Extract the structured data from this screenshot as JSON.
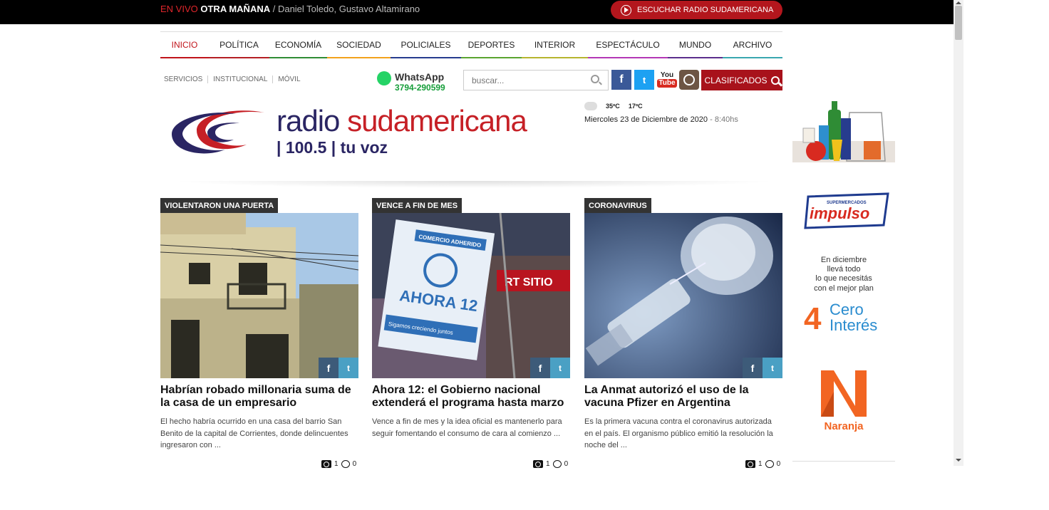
{
  "topbar": {
    "live_tag": "EN VIVO",
    "show_name": "OTRA MAÑANA",
    "hosts": " / Daniel Toledo, Gustavo Altamirano",
    "listen_button": "ESCUCHAR RADIO SUDAMERICANA",
    "listen_icon": "play-icon"
  },
  "nav": {
    "items": [
      {
        "label": "INICIO",
        "color": "#c0141a"
      },
      {
        "label": "POLÍTICA",
        "color": "#b51f24"
      },
      {
        "label": "ECONOMÍA",
        "color": "#2f8c35"
      },
      {
        "label": "SOCIEDAD",
        "color": "#f2a21c"
      },
      {
        "label": "POLICIALES",
        "color": "#273c8e"
      },
      {
        "label": "DEPORTES",
        "color": "#5aa42f"
      },
      {
        "label": "INTERIOR",
        "color": "#b7b52e"
      },
      {
        "label": "ESPECTÁCULO",
        "color": "#b437b6"
      },
      {
        "label": "MUNDO",
        "color": "#5b2e8c"
      },
      {
        "label": "ARCHIVO",
        "color": "#39a7b0"
      }
    ]
  },
  "services": [
    "SERVICIOS",
    "INSTITUCIONAL",
    "MÓVIL"
  ],
  "whatsapp": {
    "label": "WhatsApp",
    "phone": "3794-290599",
    "icon": "whatsapp-icon"
  },
  "search": {
    "placeholder": "buscar...",
    "icon": "search-icon"
  },
  "social": {
    "facebook": "f",
    "twitter": "t",
    "youtube_top": "You",
    "youtube_bottom": "Tube"
  },
  "clasificados": {
    "label": "CLASIFICADOS",
    "icon": "search-icon"
  },
  "logo": {
    "word1": "radio ",
    "word2": "sudamericana",
    "tagline": "| 100.5 | tu voz"
  },
  "weather": {
    "max": "35ºC",
    "min": "17ºC",
    "icon": "cloudy-icon"
  },
  "date": {
    "text": "Miercoles 23 de Diciembre de 2020",
    "separator": " - ",
    "time": "8:40hs"
  },
  "articles": [
    {
      "kicker": "VIOLENTARON UNA PUERTA",
      "headline": "Habrían robado millonaria suma de la casa de un empresario",
      "summary": "El hecho habría ocurrido en una casa del barrio San Benito de la capital de Corrientes, donde delincuentes ingresaron con ...",
      "photos": "1",
      "comments": "0"
    },
    {
      "kicker": "VENCE A FIN DE MES",
      "headline": "Ahora 12: el Gobierno nacional extenderá el programa hasta marzo",
      "summary": "Vence a fin de mes y la idea oficial es mantenerlo para seguir fomentando el consumo de cara al comienzo ...",
      "photos": "1",
      "comments": "0",
      "sign_top": "COMERCIO ADHERIDO",
      "sign_main": "AHORA 12",
      "sign_bottom": "Sigamos creciendo juntos",
      "store_sign": "RT SITIO"
    },
    {
      "kicker": "CORONAVIRUS",
      "headline": "La Anmat autorizó el uso de la vacuna Pfizer en Argentina",
      "summary": "Es la primera vacuna contra el coronavirus autorizada en el país. El organismo público emitió la resolución la noche del ...",
      "photos": "1",
      "comments": "0"
    }
  ],
  "share": {
    "facebook": "f",
    "twitter": "t"
  },
  "sidebar_ad": {
    "brand_small": "SUPERMERCADOS",
    "brand": "impulso",
    "text1": "En diciembre",
    "text2": "llevá todo",
    "text3": "lo que necesitás",
    "text4": "con el mejor plan",
    "promo_num": "4",
    "promo_word1": "Cero",
    "promo_word2": "Interés",
    "card_brand": "Naranja"
  }
}
